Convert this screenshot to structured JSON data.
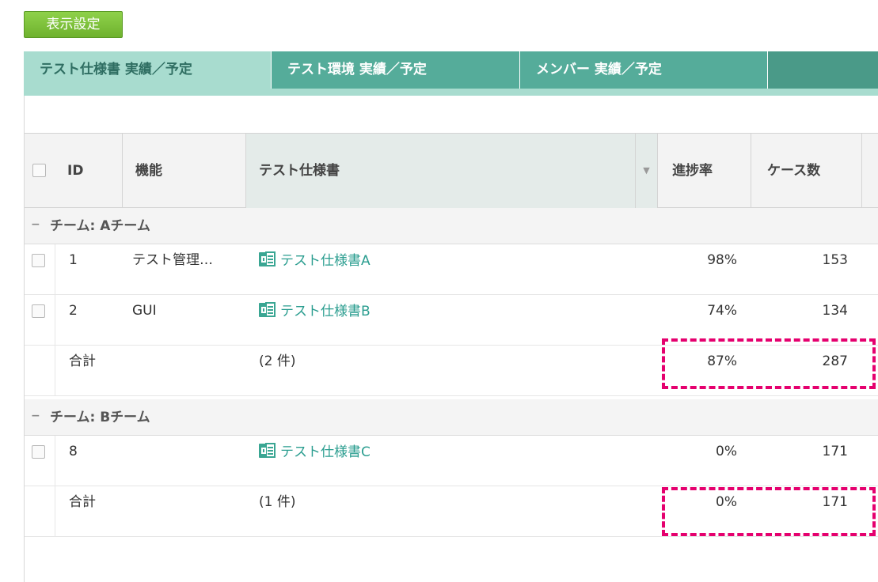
{
  "toolbar": {
    "display_settings_label": "表示設定"
  },
  "tabs": [
    {
      "label": "テスト仕様書 実績／予定"
    },
    {
      "label": "テスト環境 実績／予定"
    },
    {
      "label": "メンバー 実績／予定"
    }
  ],
  "columns": {
    "id": "ID",
    "feature": "機能",
    "spec": "テスト仕様書",
    "progress": "進捗率",
    "cases": "ケース数"
  },
  "groups": [
    {
      "label": "チーム: Aチーム",
      "rows": [
        {
          "id": "1",
          "feature": "テスト管理…",
          "spec": "テスト仕様書A",
          "progress": "98%",
          "cases": "153"
        },
        {
          "id": "2",
          "feature": "GUI",
          "spec": "テスト仕様書B",
          "progress": "74%",
          "cases": "134"
        }
      ],
      "total": {
        "label": "合計",
        "count": "(2 件)",
        "progress": "87%",
        "cases": "287"
      }
    },
    {
      "label": "チーム: Bチーム",
      "rows": [
        {
          "id": "8",
          "feature": "",
          "spec": "テスト仕様書C",
          "progress": "0%",
          "cases": "171"
        }
      ],
      "total": {
        "label": "合計",
        "count": "(1 件)",
        "progress": "0%",
        "cases": "171"
      }
    }
  ],
  "colors": {
    "accent_green": "#6fb22e",
    "tab_teal": "#55ac9a",
    "link_teal": "#2a9d8f",
    "highlight_pink": "#e5006e"
  }
}
